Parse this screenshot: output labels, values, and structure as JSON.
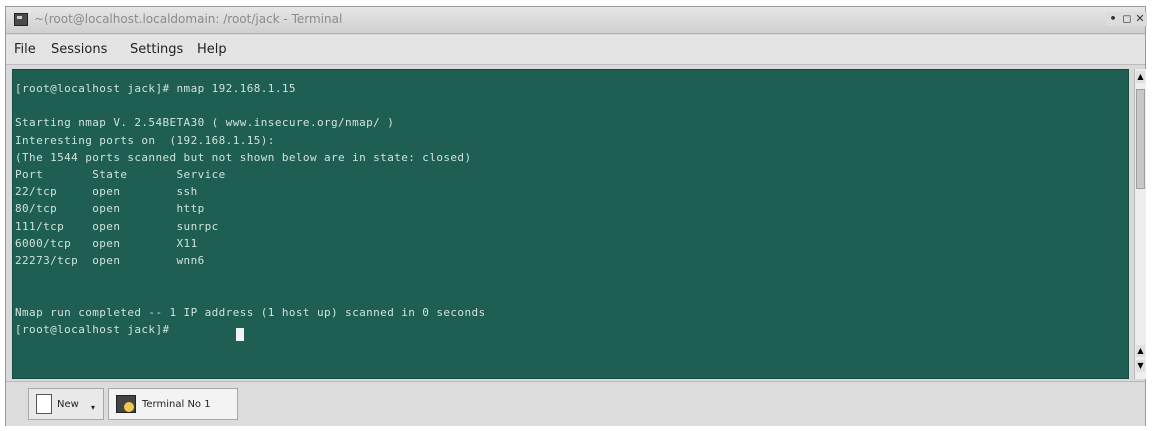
{
  "window": {
    "title": "~(root@localhost.localdomain: /root/jack - Terminal",
    "controls": [
      "minimize",
      "maximize",
      "close"
    ],
    "control_glyphs": {
      "minimize": "•",
      "maximize": "◻",
      "close": "✕"
    }
  },
  "menubar": {
    "items": [
      "File",
      "Sessions",
      "Settings",
      "Help"
    ]
  },
  "terminal": {
    "colors": {
      "background": "#1f5e53",
      "text": "#cfe3dc",
      "cursor": "#f2f2f2"
    },
    "lines": [
      "[root@localhost jack]# nmap 192.168.1.15",
      "",
      "Starting nmap V. 2.54BETA30 ( www.insecure.org/nmap/ )",
      "Interesting ports on  (192.168.1.15):",
      "(The 1544 ports scanned but not shown below are in state: closed)",
      "Port       State       Service",
      "22/tcp     open        ssh",
      "80/tcp     open        http",
      "111/tcp    open        sunrpc",
      "6000/tcp   open        X11",
      "22273/tcp  open        wnn6",
      "",
      "",
      "Nmap run completed -- 1 IP address (1 host up) scanned in 0 seconds",
      "[root@localhost jack]# "
    ]
  },
  "scrollbar": {
    "up_arrow": "▲",
    "down_arrow": "▼"
  },
  "tabbar": {
    "new_label": "New",
    "new_caret": "▾",
    "session_label": "Terminal No 1"
  }
}
